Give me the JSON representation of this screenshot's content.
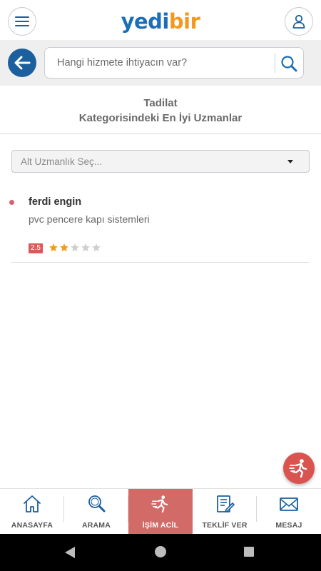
{
  "header": {
    "logo_part1": "yedi",
    "logo_part2": "bir",
    "brand_blue": "#1b6fb7",
    "brand_orange": "#f29a1d"
  },
  "search": {
    "placeholder": "Hangi hizmete ihtiyacın var?"
  },
  "title": {
    "line1": "Tadilat",
    "line2": "Kategorisindeki En İyi Uzmanlar"
  },
  "filter": {
    "placeholder": "Alt Uzmanlık Seç..."
  },
  "experts": [
    {
      "name": "ferdi engin",
      "service": "pvc pencere kapı sistemleri",
      "rating": "2.5",
      "stars_filled": 2,
      "stars_total": 5
    }
  ],
  "bottom_nav": {
    "items": [
      {
        "label": "ANASAYFA",
        "icon": "home-icon"
      },
      {
        "label": "ARAMA",
        "icon": "search-icon"
      },
      {
        "label": "İŞİM ACİL",
        "icon": "running-man-icon"
      },
      {
        "label": "TEKLİF VER",
        "icon": "quote-form-icon"
      },
      {
        "label": "MESAJ",
        "icon": "envelope-icon"
      }
    ],
    "active_index": 2,
    "active_color": "#d26a68"
  },
  "colors": {
    "accent": "#1b5f9e",
    "urgent": "#d9544f",
    "star_filled": "#f29a1d",
    "star_empty": "#cfcfcf"
  }
}
